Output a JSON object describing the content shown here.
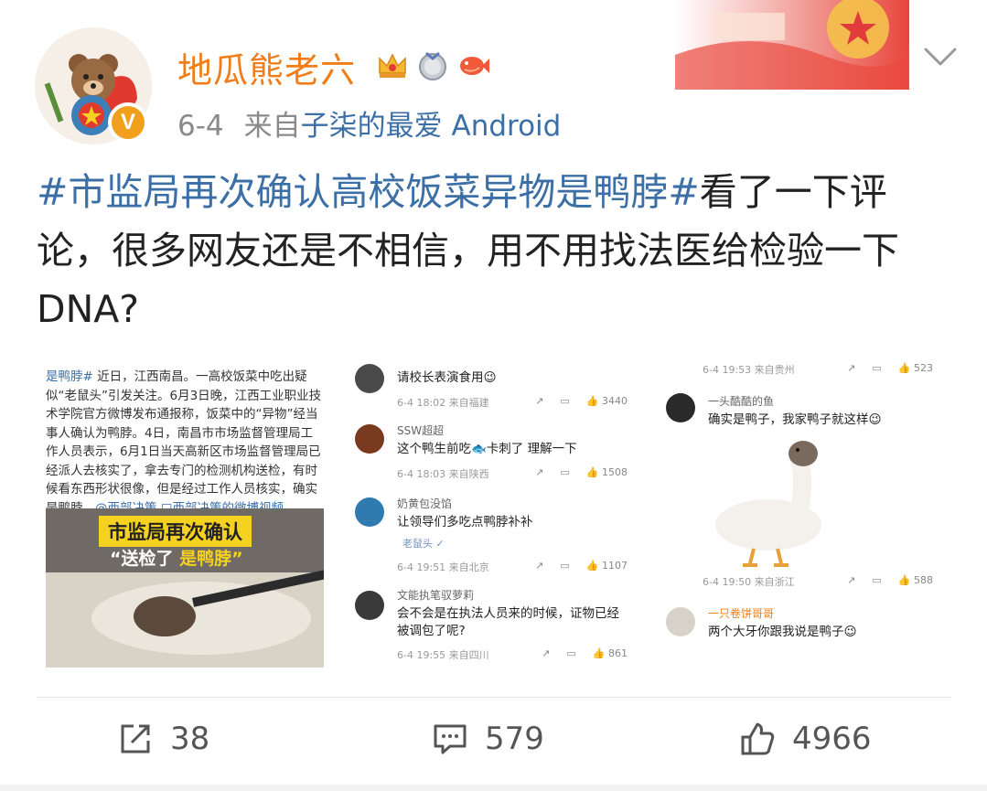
{
  "author": {
    "name": "地瓜熊老六",
    "badges": [
      "crown-badge",
      "medal-badge",
      "koi-badge"
    ],
    "verified_mark": "V"
  },
  "meta": {
    "time": "6-4",
    "source_prefix": "来自",
    "source": "子柒的最爱 Android"
  },
  "post": {
    "hashtag": "#市监局再次确认高校饭菜异物是鸭脖#",
    "text": "看了一下评论，很多网友还是不相信，用不用找法医给检验一下DNA?"
  },
  "image1": {
    "top_text": "#市监局再次确认高校饭菜异物是鸭脖#",
    "hashtag": "是鸭脖#",
    "body": " 近日，江西南昌。一高校饭菜中吃出疑似“老鼠头”引发关注。6月3日晚，江西工业职业技术学院官方微博发布通报称，饭菜中的“异物”经当事人确认为鸭脖。4日，南昌市市场监督管理局工作人员表示，6月1日当天高新区市场监督管理局已经派人去核实了，拿去专门的检测机构送检，有时候看东西形状很像，但是经过工作人员核实，确实是鸭脖。",
    "link": "@西部决策 □西部决策的微博视频",
    "caption_main": "市监局再次确认",
    "caption_sub_a": "“送检了",
    "caption_sub_b": "是鸭脖”"
  },
  "image2": {
    "comments": [
      {
        "name": "",
        "body": "请校长表演食用😉",
        "date": "6-4 18:02",
        "loc": "来自福建",
        "likes": "3440"
      },
      {
        "name": "SSW超超",
        "body": "这个鸭生前吃🐟卡刺了 理解一下",
        "date": "6-4 18:03",
        "loc": "来自陕西",
        "likes": "1508"
      },
      {
        "name": "奶黄包没馅",
        "body": "让领导们多吃点鸭脖补补",
        "tag": "老鼠头 ✓",
        "date": "6-4 19:51",
        "loc": "来自北京",
        "likes": "1107"
      },
      {
        "name": "文能执笔驭萝莉",
        "body": "会不会是在执法人员来的时候，证物已经被调包了呢?",
        "date": "6-4 19:55",
        "loc": "来自四川",
        "likes": "861"
      }
    ]
  },
  "image3": {
    "top_footer": {
      "date": "6-4 19:53",
      "loc": "来自贵州",
      "likes": "523"
    },
    "comments": [
      {
        "name": "一头酷酷的鱼",
        "body": "确实是鸭子，我家鸭子就这样😉",
        "date": "6-4 19:50",
        "loc": "来自浙江",
        "likes": "588"
      },
      {
        "name": "一只卷饼哥哥",
        "body": "两个大牙你跟我说是鸭子😉"
      }
    ]
  },
  "actions": {
    "repost": "38",
    "comment": "579",
    "like": "4966"
  },
  "colors": {
    "username": "#f07d18",
    "link": "#3b6fa6",
    "meta": "#8a8a8a"
  }
}
